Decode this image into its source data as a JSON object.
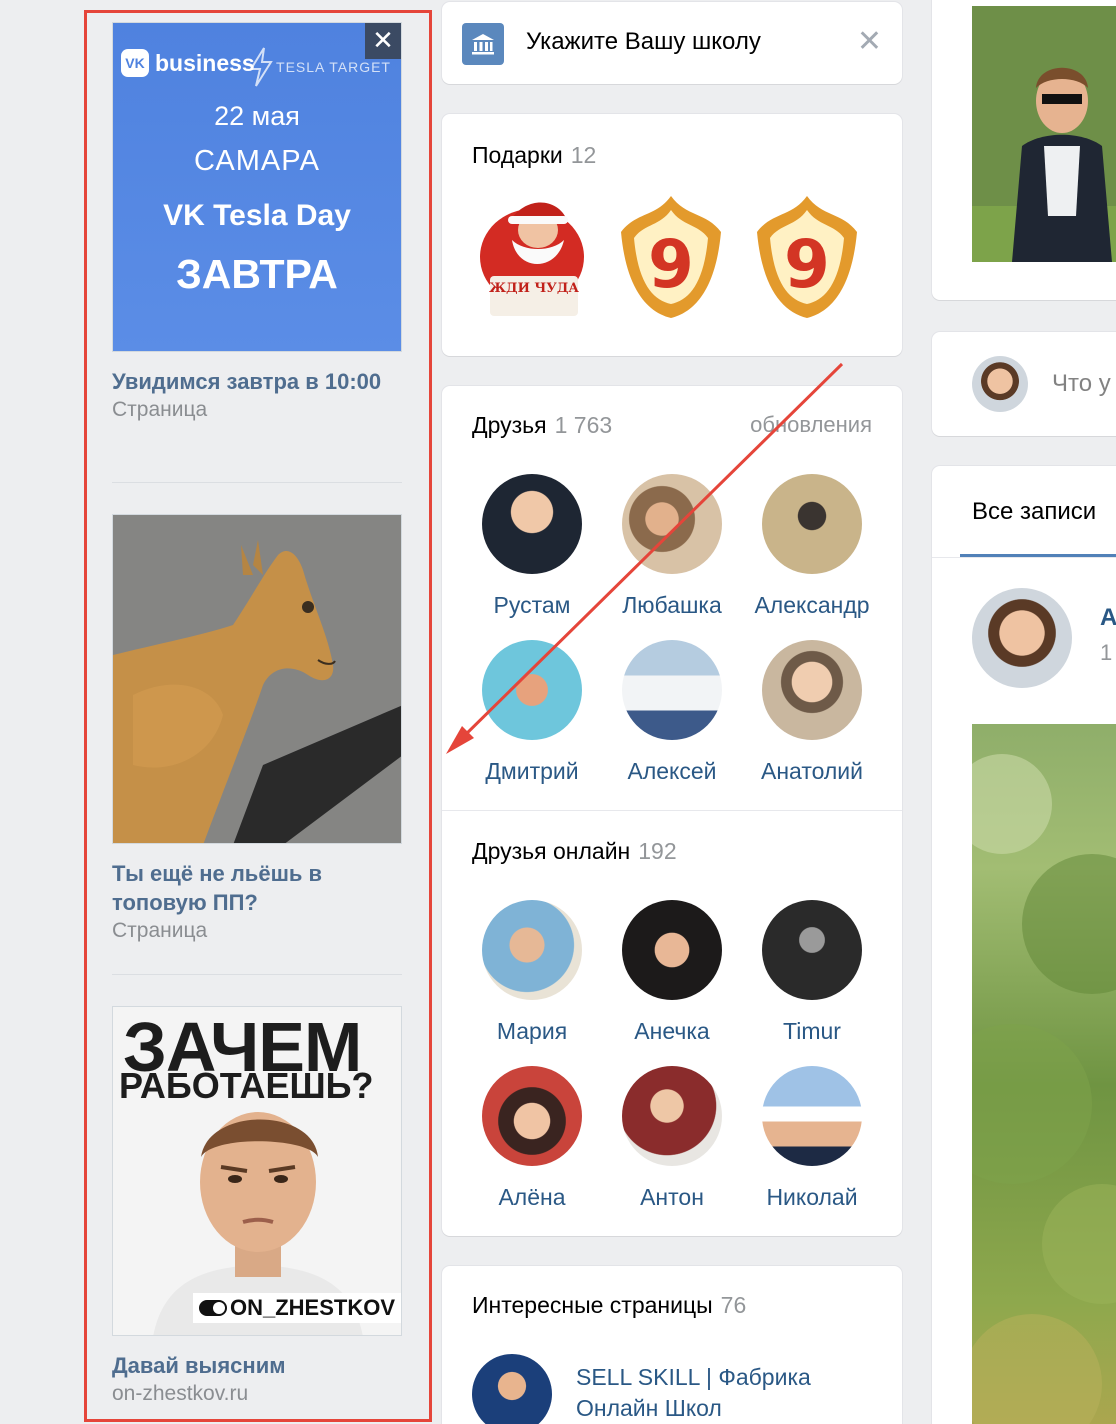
{
  "ads": [
    {
      "title": "Увидимся завтра в 10:00",
      "subtitle": "Страница",
      "banner": {
        "brand": "business",
        "brand_logo": "VK",
        "partner": "TESLA TARGET",
        "date": "22 мая",
        "city": "САМАРА",
        "event": "VK Tesla Day",
        "when": "ЗАВТРА",
        "close": "✕"
      }
    },
    {
      "title": "Ты ещё не льёшь в топовую ПП?",
      "subtitle": "Страница"
    },
    {
      "title": "Давай выясним",
      "subtitle": "on-zhestkov.ru",
      "banner": {
        "headline_1": "ЗАЧЕМ",
        "headline_2": "РАБОТАЕШЬ?",
        "tag": "ON_ZHESTKOV"
      }
    }
  ],
  "school": {
    "text": "Укажите Вашу школу",
    "close": "✕"
  },
  "gifts": {
    "title": "Подарки",
    "count": "12",
    "santa_text": "ЖДИ ЧУДА",
    "badge_text": "9"
  },
  "friends": {
    "title": "Друзья",
    "count": "1 763",
    "updates": "обновления",
    "items": [
      "Рустам",
      "Любашка",
      "Александр",
      "Дмитрий",
      "Алексей",
      "Анатолий"
    ]
  },
  "friends_online": {
    "title": "Друзья онлайн",
    "count": "192",
    "items": [
      "Мария",
      "Анечка",
      "Timur",
      "Алёна",
      "Антон",
      "Николай"
    ]
  },
  "pages": {
    "title": "Интересные страницы",
    "count": "76",
    "first_name_line1": "SELL SKILL | Фабрика",
    "first_name_line2": "Онлайн Школ"
  },
  "right": {
    "composer_placeholder": "Что у",
    "tab_all": "Все записи",
    "post_author": "А",
    "post_meta": "1"
  },
  "colors": {
    "highlight": "#e5453a",
    "link": "#2a5885",
    "banner": "#5b8de6",
    "school_icon": "#5b88bd"
  }
}
